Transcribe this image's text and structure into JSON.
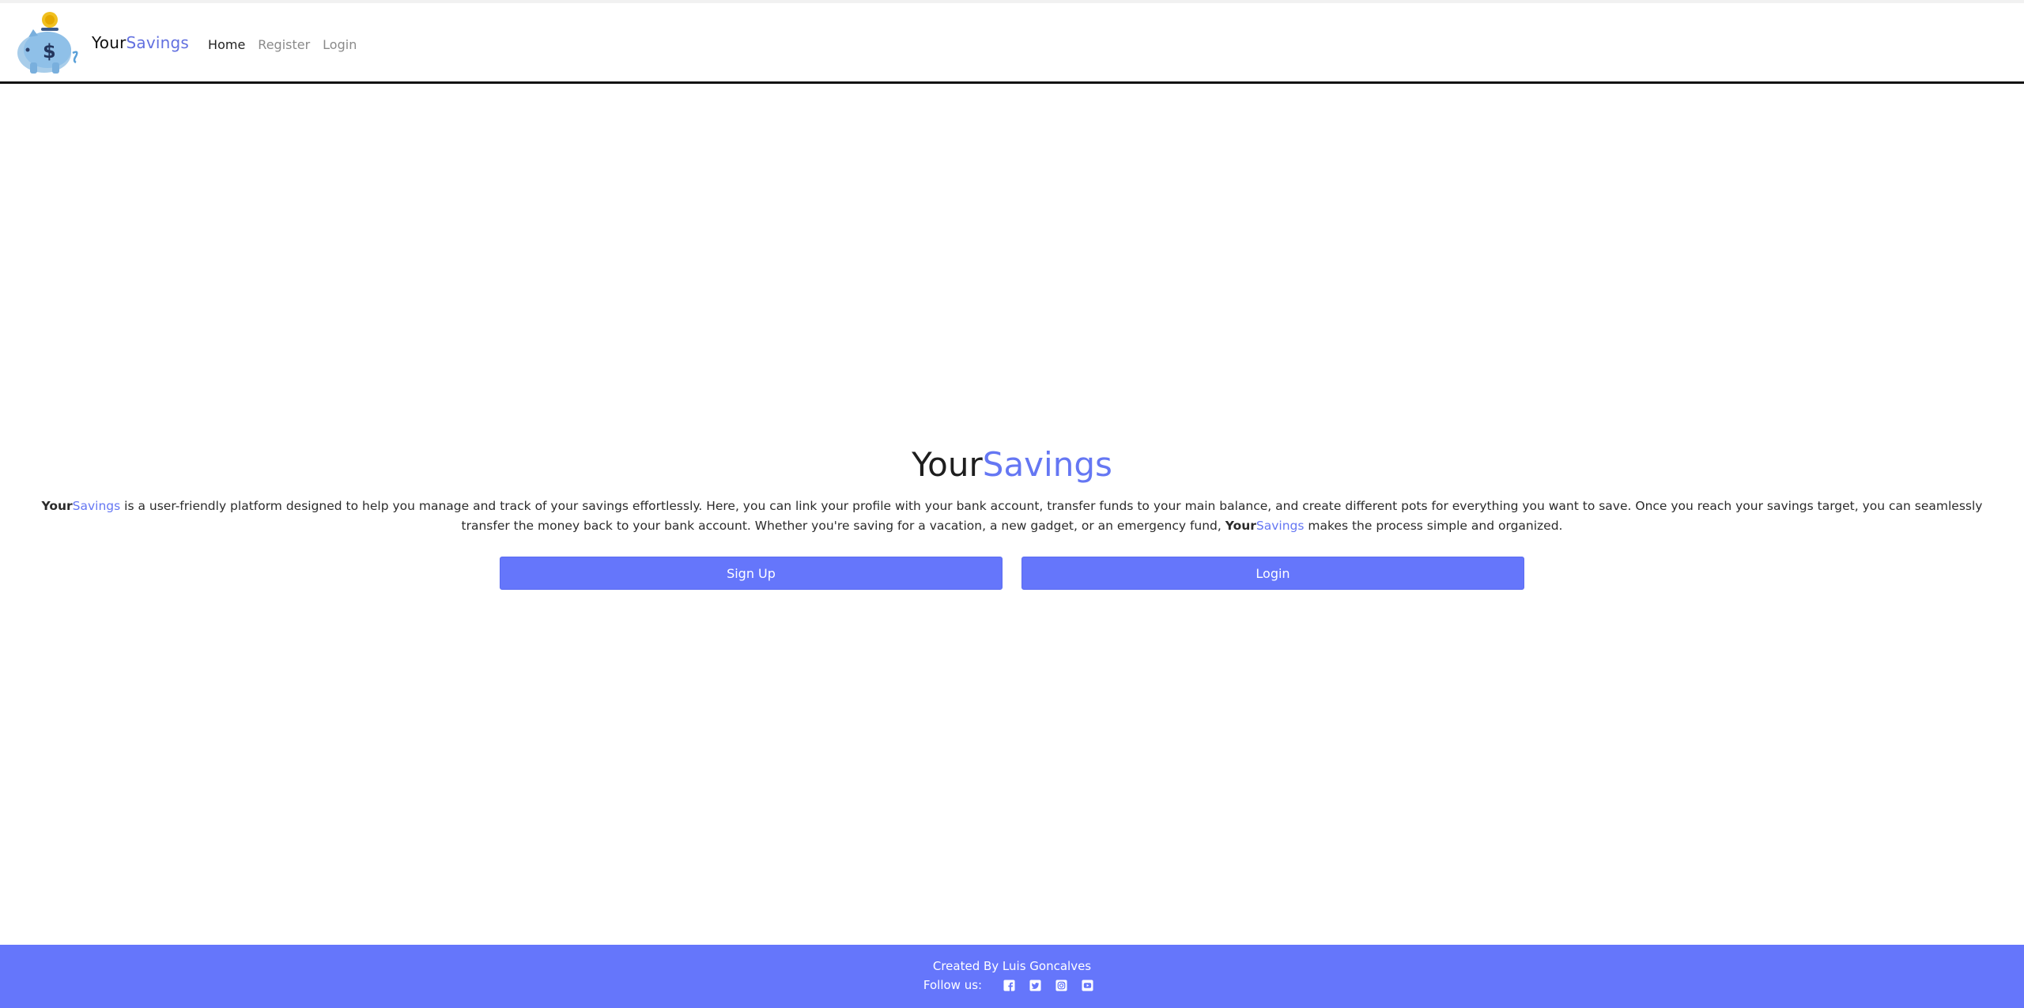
{
  "brand": {
    "your": "Your",
    "savings": "Savings"
  },
  "nav": {
    "home": "Home",
    "register": "Register",
    "login": "Login"
  },
  "hero": {
    "title_your": "Your",
    "title_savings": "Savings",
    "desc_your": "Your",
    "desc_savings": "Savings",
    "desc_part1": " is a user-friendly platform designed to help you manage and track of your savings effortlessly. Here, you can link your profile with your bank account, transfer funds to your main balance, and create different pots for everything you want to save. Once you reach your savings target, you can seamlessly transfer the money back to your bank account. Whether you're saving for a vacation, a new gadget, or an emergency fund, ",
    "desc_your2": "Your",
    "desc_savings2": "Savings",
    "desc_part2": " makes the process simple and organized."
  },
  "buttons": {
    "signup": "Sign Up",
    "login": "Login"
  },
  "footer": {
    "credit": "Created By Luis Goncalves",
    "follow": "Follow us:",
    "icons": [
      "facebook-icon",
      "twitter-icon",
      "instagram-icon",
      "youtube-icon"
    ]
  },
  "colors": {
    "accent": "#6576fb",
    "brand_text": "#6577f3"
  }
}
